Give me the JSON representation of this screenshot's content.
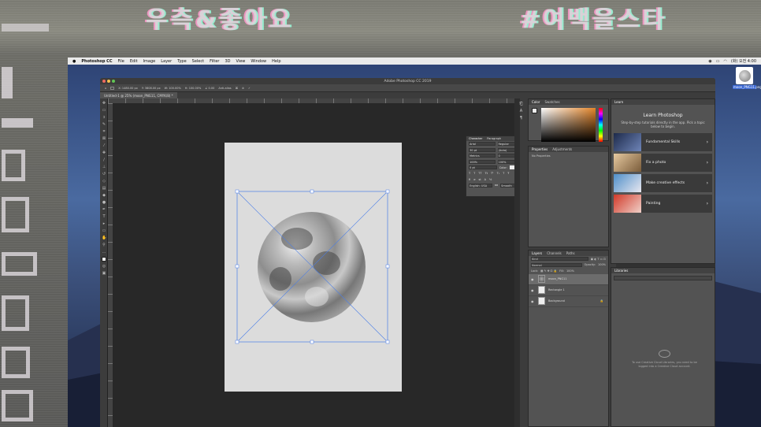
{
  "menubar": {
    "app": "Photoshop CC",
    "items": [
      "File",
      "Edit",
      "Image",
      "Layer",
      "Type",
      "Select",
      "Filter",
      "3D",
      "View",
      "Window",
      "Help"
    ],
    "clock": "(화) 오전 4:00"
  },
  "window": {
    "title": "Adobe Photoshop CC 2019",
    "document_tab": "Untitled-1 @ 25% (moon_PNG11, CMYK/8) *"
  },
  "options": {
    "x": "X: 1480.00 px",
    "y": "Y: 3808.00 px",
    "w": "W: 100.00%",
    "h": "H: 100.00%",
    "angle": "∠ 0.00",
    "interp": "Anti-alias"
  },
  "desktop": {
    "file_icon_label": "moon_PNG11.png"
  },
  "character": {
    "tab1": "Character",
    "tab2": "Paragraph",
    "font": "Arial",
    "style": "Regular",
    "size": "30 pt",
    "leading": "(Auto)",
    "kerning": "Metrics",
    "tracking": "0",
    "vscale": "100%",
    "hscale": "100%",
    "baseline": "0 pt",
    "color_label": "Color:",
    "lang": "English: USA",
    "aa": "aa",
    "smooth": "Smooth"
  },
  "color_panel": {
    "tab1": "Color",
    "tab2": "Swatches"
  },
  "properties": {
    "tab1": "Properties",
    "tab2": "Adjustments",
    "empty": "No Properties"
  },
  "layers_panel": {
    "tab1": "Layers",
    "tab2": "Channels",
    "tab3": "Paths",
    "kind": "Kind",
    "blend": "Normal",
    "opacity_label": "Opacity:",
    "opacity": "100%",
    "lock_label": "Lock:",
    "fill_label": "Fill:",
    "fill": "100%",
    "layers": [
      {
        "name": "moon_PNG11",
        "selected": true
      },
      {
        "name": "Rectangle 1",
        "selected": false
      },
      {
        "name": "Background",
        "selected": false
      }
    ]
  },
  "learn": {
    "tab": "Learn",
    "title": "Learn Photoshop",
    "subtitle": "Step-by-step tutorials directly in the app. Pick a topic below to begin.",
    "cards": [
      {
        "label": "Fundamental Skills"
      },
      {
        "label": "Fix a photo"
      },
      {
        "label": "Make creative effects"
      },
      {
        "label": "Painting"
      }
    ]
  },
  "libraries": {
    "tab": "Libraries",
    "message": "To use Creative Cloud Libraries, you need to be logged into a Creative Cloud account."
  },
  "video_overlay": {
    "top_left": "우측&좋아요",
    "top_right": "#여백을스타"
  }
}
